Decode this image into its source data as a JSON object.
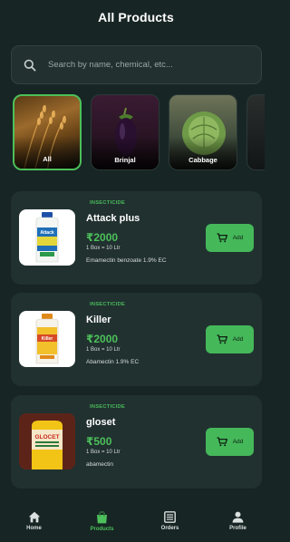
{
  "header": {
    "title": "All Products"
  },
  "search": {
    "placeholder": "Search by name, chemical, etc..."
  },
  "categories": [
    {
      "label": "All",
      "selected": true
    },
    {
      "label": "Brinjal",
      "selected": false
    },
    {
      "label": "Cabbage",
      "selected": false
    }
  ],
  "products": [
    {
      "tag": "INSECTICIDE",
      "name": "Attack plus",
      "price": "₹2000",
      "qty": "1 Box = 10 Ltr",
      "chemical": "Emamectin benzoate 1.9% EC",
      "add_label": "Add",
      "image_text": "Attack"
    },
    {
      "tag": "INSECTICIDE",
      "name": "Killer",
      "price": "₹2000",
      "qty": "1 Box = 10 Ltr",
      "chemical": "Abamectin 1.9% EC",
      "add_label": "Add",
      "image_text": "Killer"
    },
    {
      "tag": "INSECTICIDE",
      "name": "gloset",
      "price": "₹500",
      "qty": "1 Box = 10 Ltr",
      "chemical": "abamectin",
      "add_label": "Add",
      "image_text": "GLOCET"
    }
  ],
  "nav": [
    {
      "label": "Home",
      "icon": "home-icon",
      "active": false
    },
    {
      "label": "Products",
      "icon": "shopping-bag-icon",
      "active": true
    },
    {
      "label": "Orders",
      "icon": "orders-icon",
      "active": false
    },
    {
      "label": "Profile",
      "icon": "person-icon",
      "active": false
    }
  ],
  "colors": {
    "background": "#172524",
    "card": "#213130",
    "accent": "#45b85a"
  }
}
